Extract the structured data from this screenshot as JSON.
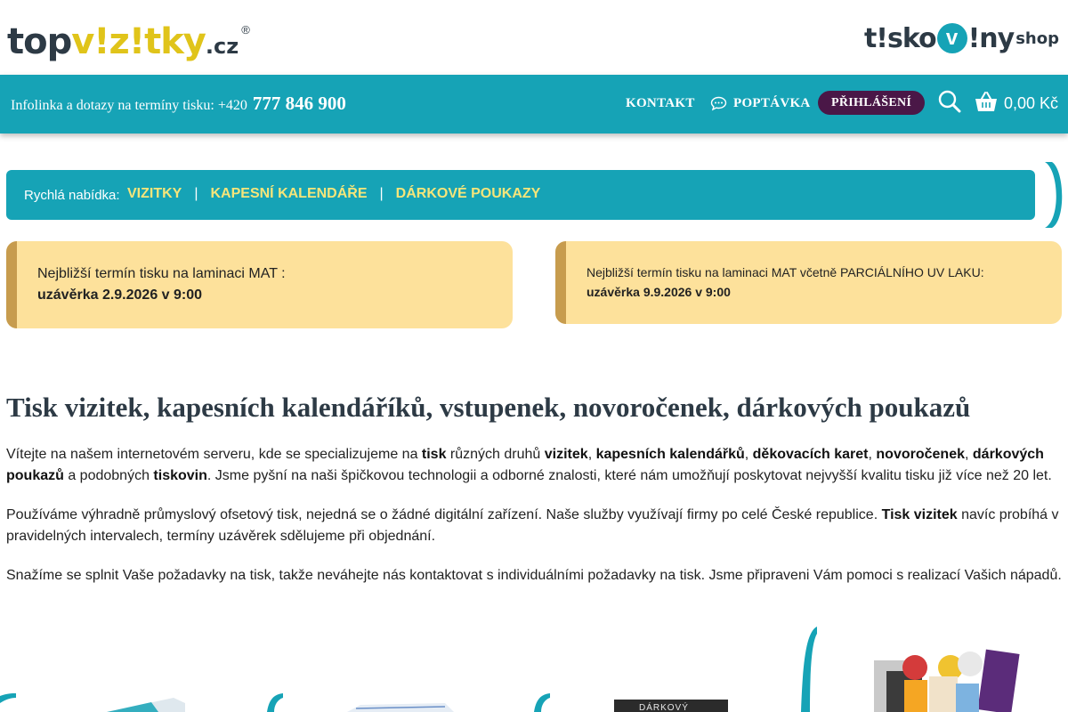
{
  "header": {
    "logo_left": {
      "part1": "top",
      "part2": "v!z!tky",
      "part3": ".cz",
      "reg": "®"
    },
    "logo_right": {
      "part1": "t!sko",
      "part2": "v",
      "part3": "!ny",
      "part4": "shop"
    }
  },
  "topbar": {
    "infoline_label": "Infolinka a dotazy na termíny tisku: +420",
    "phone": "777 846 900",
    "nav": {
      "kontakt": "KONTAKT",
      "poptavka": "POPTÁVKA",
      "login": "PŘIHLÁŠENÍ"
    },
    "cart_total": "0,00 Kč"
  },
  "quick_offer": {
    "label": "Rychlá nabídka:",
    "links": [
      "VIZITKY",
      "KAPESNÍ KALENDÁŘE",
      "DÁRKOVÉ POUKAZY"
    ],
    "separator": "|"
  },
  "deadlines": [
    {
      "title": "Nejbližší termín tisku na laminaci MAT :",
      "deadline": "uzávěrka 2.9.2026 v 9:00"
    },
    {
      "title": "Nejbližší termín tisku na laminaci MAT včetně PARCIÁLNÍHO UV LAKU:",
      "deadline": "uzávěrka 9.9.2026 v 9:00"
    }
  ],
  "main": {
    "heading": "Tisk vizitek, kapesních kalendáříků, vstupenek, novoročenek, dárkových poukazů",
    "p1": {
      "t1": "Vítejte na našem internetovém serveru, kde se specializujeme na ",
      "b1": "tisk",
      "t2": " různých druhů ",
      "b2": "vizitek",
      "t3": ", ",
      "b3": "kapesních kalendářků",
      "t4": ", ",
      "b4": "děkovacích karet",
      "t5": ", ",
      "b5": "novoročenek",
      "t6": ", ",
      "b6": "dárkových poukazů",
      "t7": " a podobných ",
      "b7": "tiskovin",
      "t8": ". Jsme pyšní na naši špičkovou technologii a odborné znalosti, které nám umožňují poskytovat nejvyšší kvalitu tisku již více než 20 let."
    },
    "p2": {
      "t1": "Používáme výhradně průmyslový ofsetový tisk, nejedná se o žádné digitální zařízení. Naše služby využívají firmy po celé České republice. ",
      "b1": "Tisk vizitek",
      "t2": " navíc probíhá v pravidelných intervalech, termíny uzávěrek sdělujeme při objednání."
    },
    "p3": "Snažíme se splnit Vaše požadavky na tisk, takže neváhejte nás kontaktovat s individuálními požadavky na tisk. Jsme připraveni Vám pomoci s realizací Vašich nápadů.",
    "tiles": {
      "voucher_text": "DÁRKOVÝ"
    }
  },
  "colors": {
    "teal": "#16a3b6",
    "login_purple": "#4a1747",
    "quick_link_yellow": "#f6e57a",
    "card_bg": "#fde19b",
    "card_edge": "#c79c4e"
  },
  "icons": [
    "chat-icon",
    "search-icon",
    "cart-icon"
  ]
}
